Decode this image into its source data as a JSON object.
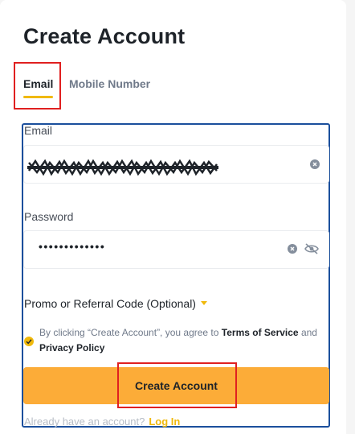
{
  "page": {
    "title": "Create Account"
  },
  "tabs": [
    {
      "label": "Email",
      "active": true
    },
    {
      "label": "Mobile Number",
      "active": false
    }
  ],
  "email": {
    "label": "Email",
    "value": "xxxxxxxxxxxxxxxxxxxxxxxxx",
    "value_obscured": true
  },
  "password": {
    "label": "Password",
    "masked_value": "•••••••••••••"
  },
  "promo": {
    "label": "Promo or Referral Code (Optional)"
  },
  "agreement": {
    "checked": true,
    "prefix": "By clicking “Create Account”, you agree to ",
    "terms_label": "Terms of Service",
    "conjunction": " and ",
    "privacy_label": "Privacy Policy"
  },
  "submit": {
    "label": "Create Account"
  },
  "login": {
    "prompt": "Already have an account?",
    "link_label": "Log In"
  },
  "colors": {
    "accent": "#f0b90b",
    "button": "#fcac38",
    "highlight": "#e02020",
    "focus_outline": "#1b4f9c",
    "text_primary": "#1e2329",
    "text_secondary": "#707a8a"
  },
  "icons": {
    "clear": "clear-circle-icon",
    "toggle_visibility": "eye-slash-icon",
    "caret": "caret-down-icon",
    "check": "check-circle-icon"
  }
}
